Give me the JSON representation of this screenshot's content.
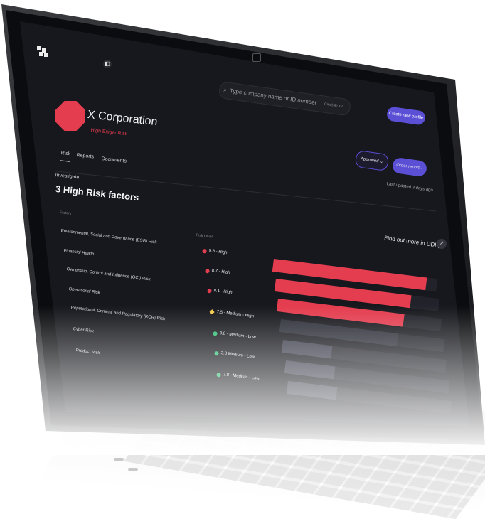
{
  "app": {
    "search_placeholder": "Type company name or ID number",
    "search_shortcut": "Cmd(⌘) + /",
    "create_button": "Create new profile",
    "sidebar_toggle": "◧"
  },
  "company": {
    "name": "X Corporation",
    "risk_tag": "High Exiger Risk",
    "badge_color": "#e43d4f"
  },
  "tabs": [
    "Risk",
    "Reports",
    "Documents"
  ],
  "actions": {
    "approved": "Approved",
    "approved_caret": "⌄",
    "order_report": "Order report",
    "order_icon": "+",
    "last_updated": "Last updated 3 days ago"
  },
  "section": {
    "investigate": "Investigate",
    "headline": "3 High Risk factors",
    "factors_header": "Factors",
    "risk_level_header": "Risk Level",
    "ddiq_link": "Find out more in DDIQ",
    "ddiq_icon": "↗"
  },
  "colors": {
    "high": "#e43d4f",
    "medium_high": "#f2c94c",
    "medium_low": "#2fbf71",
    "low_bar": "#3a3c4a",
    "accent": "#5b4fd6"
  },
  "factors": [
    {
      "name": "Environmental, Social and Governance  (ESG) Risk",
      "level_text": "9.8 - High",
      "score": 9.8,
      "severity": "high"
    },
    {
      "name": "Financial Health",
      "level_text": "8.7 - High",
      "score": 8.7,
      "severity": "high"
    },
    {
      "name": "Ownership, Control and Influence (OCI) Risk",
      "level_text": "8.1 - High",
      "score": 8.1,
      "severity": "high"
    },
    {
      "name": "Operational Risk",
      "level_text": "7.5 - Medium - High",
      "score": 7.5,
      "severity": "medium_high"
    },
    {
      "name": "Reputational, Criminal and Regulatory (RCR) Risk",
      "level_text": "3.8 - Medium - Low",
      "score": 3.8,
      "severity": "medium_low"
    },
    {
      "name": "Cyber Risk",
      "level_text": "3.8 Medium - Low",
      "score": 3.8,
      "severity": "medium_low"
    },
    {
      "name": "Product Risk",
      "level_text": "3.8 - Medium - Low",
      "score": 3.8,
      "severity": "medium_low"
    }
  ]
}
